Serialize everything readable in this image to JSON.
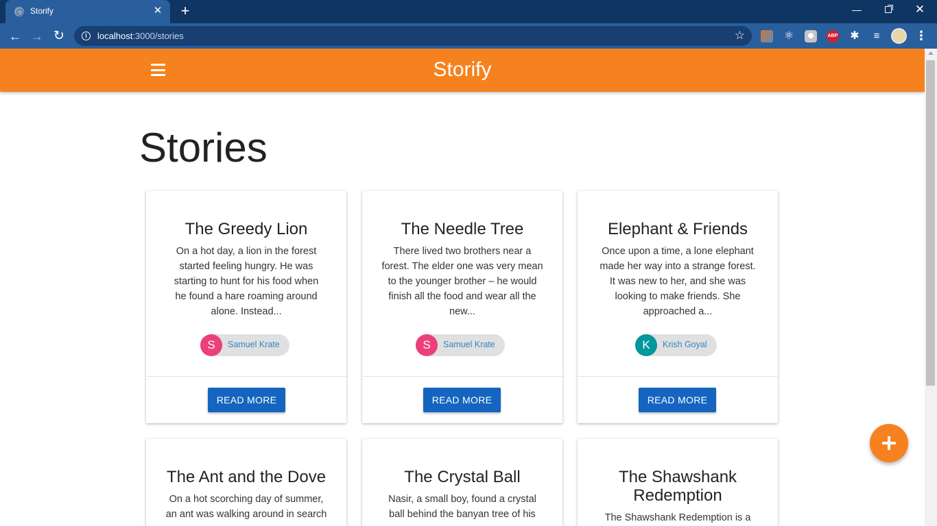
{
  "browser": {
    "tab_title": "Storify",
    "url_host": "localhost",
    "url_path": ":3000/stories"
  },
  "appbar": {
    "title": "Storify"
  },
  "page": {
    "heading": "Stories"
  },
  "stories": [
    {
      "title": "The Greedy Lion",
      "excerpt_lines": [
        "On a hot day, a lion in the forest",
        "started feeling hungry. He was",
        "starting to hunt for his food when",
        "he found a hare roaming around",
        "alone. Instead..."
      ],
      "author_initial": "S",
      "author_name": "Samuel Krate",
      "avatar_color": "#ec407a",
      "button_label": "READ MORE"
    },
    {
      "title": "The Needle Tree",
      "excerpt_lines": [
        "There lived two brothers near a",
        "forest. The elder one was very mean",
        "to the younger brother – he would",
        "finish all the food and wear all the",
        "new..."
      ],
      "author_initial": "S",
      "author_name": "Samuel Krate",
      "avatar_color": "#ec407a",
      "button_label": "READ MORE"
    },
    {
      "title": "Elephant & Friends",
      "excerpt_lines": [
        "Once upon a time, a lone elephant",
        "made her way into a strange forest.",
        "It was new to her, and she was",
        "looking to make friends. She",
        "approached a..."
      ],
      "author_initial": "K",
      "author_name": "Krish Goyal",
      "avatar_color": "#00979d",
      "button_label": "READ MORE"
    },
    {
      "title": "The Ant and the Dove",
      "excerpt_lines": [
        "On a hot scorching day of summer,",
        "an ant was walking around in search"
      ]
    },
    {
      "title": "The Crystal Ball",
      "excerpt_lines": [
        "Nasir, a small boy, found a crystal",
        "ball behind the banyan tree of his"
      ]
    },
    {
      "title_lines": [
        "The Shawshank",
        "Redemption"
      ],
      "excerpt_lines": [
        "The Shawshank Redemption is a"
      ]
    }
  ],
  "colors": {
    "appbar": "#f5821f",
    "button": "#1565c0",
    "fab": "#f5821f"
  }
}
